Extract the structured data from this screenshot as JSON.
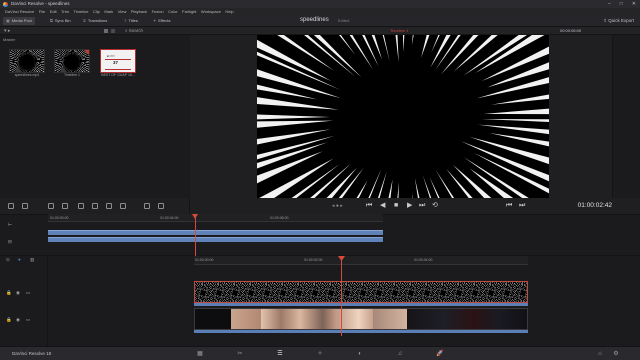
{
  "window": {
    "title": "DaVinci Resolve - speedlines"
  },
  "menu": [
    "DaVinci Resolve",
    "File",
    "Edit",
    "Trim",
    "Timeline",
    "Clip",
    "Mark",
    "View",
    "Playback",
    "Fusion",
    "Color",
    "Fairlight",
    "Workspace",
    "Help"
  ],
  "toolbar": {
    "media_pool": "Media Pool",
    "sync_bin": "Sync Bin",
    "transitions": "Transitions",
    "titles": "Titles",
    "effects": "Effects",
    "project_title": "speedlines",
    "project_status": "Edited",
    "quick_export": "Quick Export"
  },
  "media_pool": {
    "search_label": "Search",
    "bin_label": "Master",
    "clips": [
      {
        "name": "speedlines.mp4",
        "thumb": "burst"
      },
      {
        "name": "Timeline 1",
        "thumb": "burst"
      },
      {
        "name": "BEST OF GUAP 18...",
        "thumb": "doc",
        "doc_number": "37"
      }
    ]
  },
  "viewer": {
    "timeline_name": "Timeline 1",
    "header_timecode": "00:00:06:00",
    "timecode": "01:00:02:42"
  },
  "upper_timeline": {
    "timecodes": [
      "01:00:00:00",
      "01:00:04:00",
      "01:00:08:00"
    ]
  },
  "lower_timeline": {
    "timecodes": [
      "01:00:00:00",
      "01:00:02:00",
      "01:00:04:00"
    ]
  },
  "app": {
    "name": "DaVinci Resolve 18"
  },
  "colors": {
    "accent_red": "#d64a3b",
    "clip_blue": "#5f83b8",
    "background": "#1e1e21"
  }
}
